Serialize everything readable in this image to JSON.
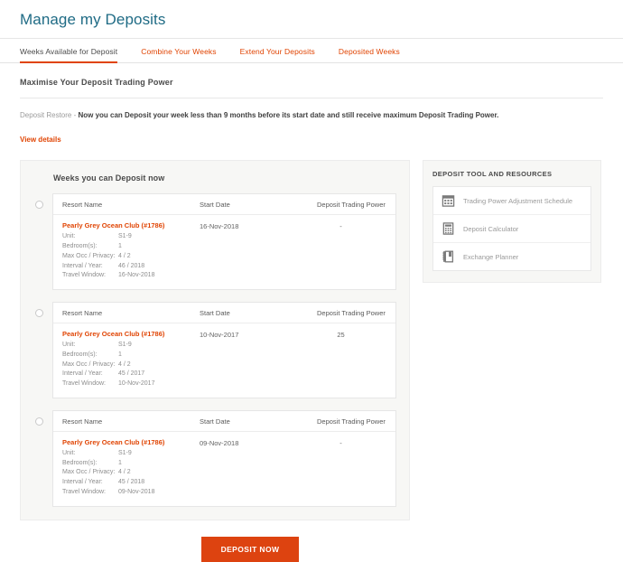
{
  "header": {
    "title": "Manage my Deposits"
  },
  "tabs": [
    {
      "label": "Weeks Available for Deposit",
      "active": true
    },
    {
      "label": "Combine Your Weeks",
      "active": false
    },
    {
      "label": "Extend Your Deposits",
      "active": false
    },
    {
      "label": "Deposited Weeks",
      "active": false
    }
  ],
  "intro": {
    "heading": "Maximise Your Deposit Trading Power",
    "note_muted": "Deposit Restore - ",
    "note_strong": "Now you can Deposit your week less than 9 months before its start date and still receive maximum Deposit Trading Power.",
    "view_details": "View details"
  },
  "deposit_panel": {
    "heading": "Weeks you can Deposit now",
    "columns": {
      "resort": "Resort Name",
      "start_date": "Start Date",
      "trading_power": "Deposit Trading Power"
    },
    "spec_labels": {
      "unit": "Unit:",
      "bedrooms": "Bedroom(s):",
      "occupancy": "Max Occ / Privacy:",
      "interval": "Interval / Year:",
      "travel_window": "Travel Window:"
    },
    "weeks": [
      {
        "resort": "Pearly Grey Ocean Club (#1786)",
        "start_date": "16-Nov-2018",
        "trading_power": "-",
        "unit": "S1-9",
        "bedrooms": "1",
        "occupancy": "4 / 2",
        "interval": "46 / 2018",
        "travel_window": "16-Nov-2018"
      },
      {
        "resort": "Pearly Grey Ocean Club (#1786)",
        "start_date": "10-Nov-2017",
        "trading_power": "25",
        "unit": "S1-9",
        "bedrooms": "1",
        "occupancy": "4 / 2",
        "interval": "45 / 2017",
        "travel_window": "10-Nov-2017"
      },
      {
        "resort": "Pearly Grey Ocean Club (#1786)",
        "start_date": "09-Nov-2018",
        "trading_power": "-",
        "unit": "S1-9",
        "bedrooms": "1",
        "occupancy": "4 / 2",
        "interval": "45 / 2018",
        "travel_window": "09-Nov-2018"
      }
    ]
  },
  "tools": {
    "title": "DEPOSIT TOOL AND RESOURCES",
    "items": [
      {
        "label": "Trading Power Adjustment Schedule",
        "icon": "calendar-icon"
      },
      {
        "label": "Deposit Calculator",
        "icon": "calculator-icon"
      },
      {
        "label": "Exchange Planner",
        "icon": "book-icon"
      }
    ]
  },
  "footer": {
    "deposit_now": "DEPOSIT NOW"
  },
  "colors": {
    "accent": "#e04403",
    "button": "#dd4310",
    "title": "#1f6b85",
    "panel_bg": "#f7f7f5"
  }
}
